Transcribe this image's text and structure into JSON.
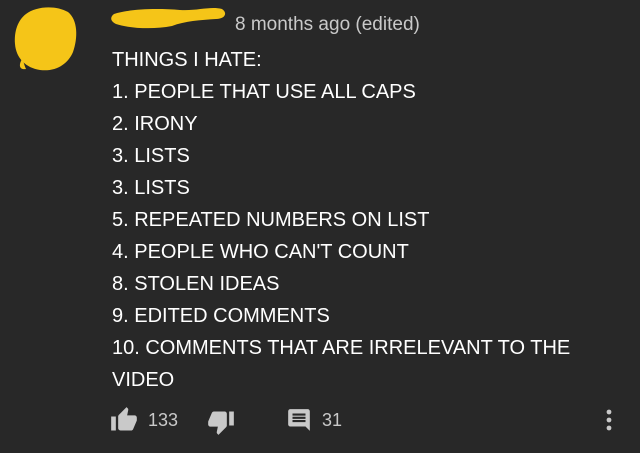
{
  "comment": {
    "meta": "8 months ago (edited)",
    "lines": [
      "THINGS I HATE:",
      "1. PEOPLE THAT USE ALL CAPS",
      "2. IRONY",
      "3. LISTS",
      "3. LISTS",
      "5. REPEATED NUMBERS ON LIST",
      "4. PEOPLE WHO CAN'T COUNT",
      "8. STOLEN IDEAS",
      "9. EDITED COMMENTS",
      "10. COMMENTS THAT ARE IRRELEVANT TO THE VIDEO"
    ]
  },
  "actions": {
    "like_count": "133",
    "reply_count": "31"
  },
  "icons": {
    "like": "thumb-up-icon",
    "dislike": "thumb-down-icon",
    "reply": "comment-icon",
    "more": "more-vertical-icon"
  },
  "colors": {
    "background": "#282828",
    "text": "#ffffff",
    "secondary_text": "#c9c9c9",
    "avatar_redaction": "#f5c518"
  }
}
